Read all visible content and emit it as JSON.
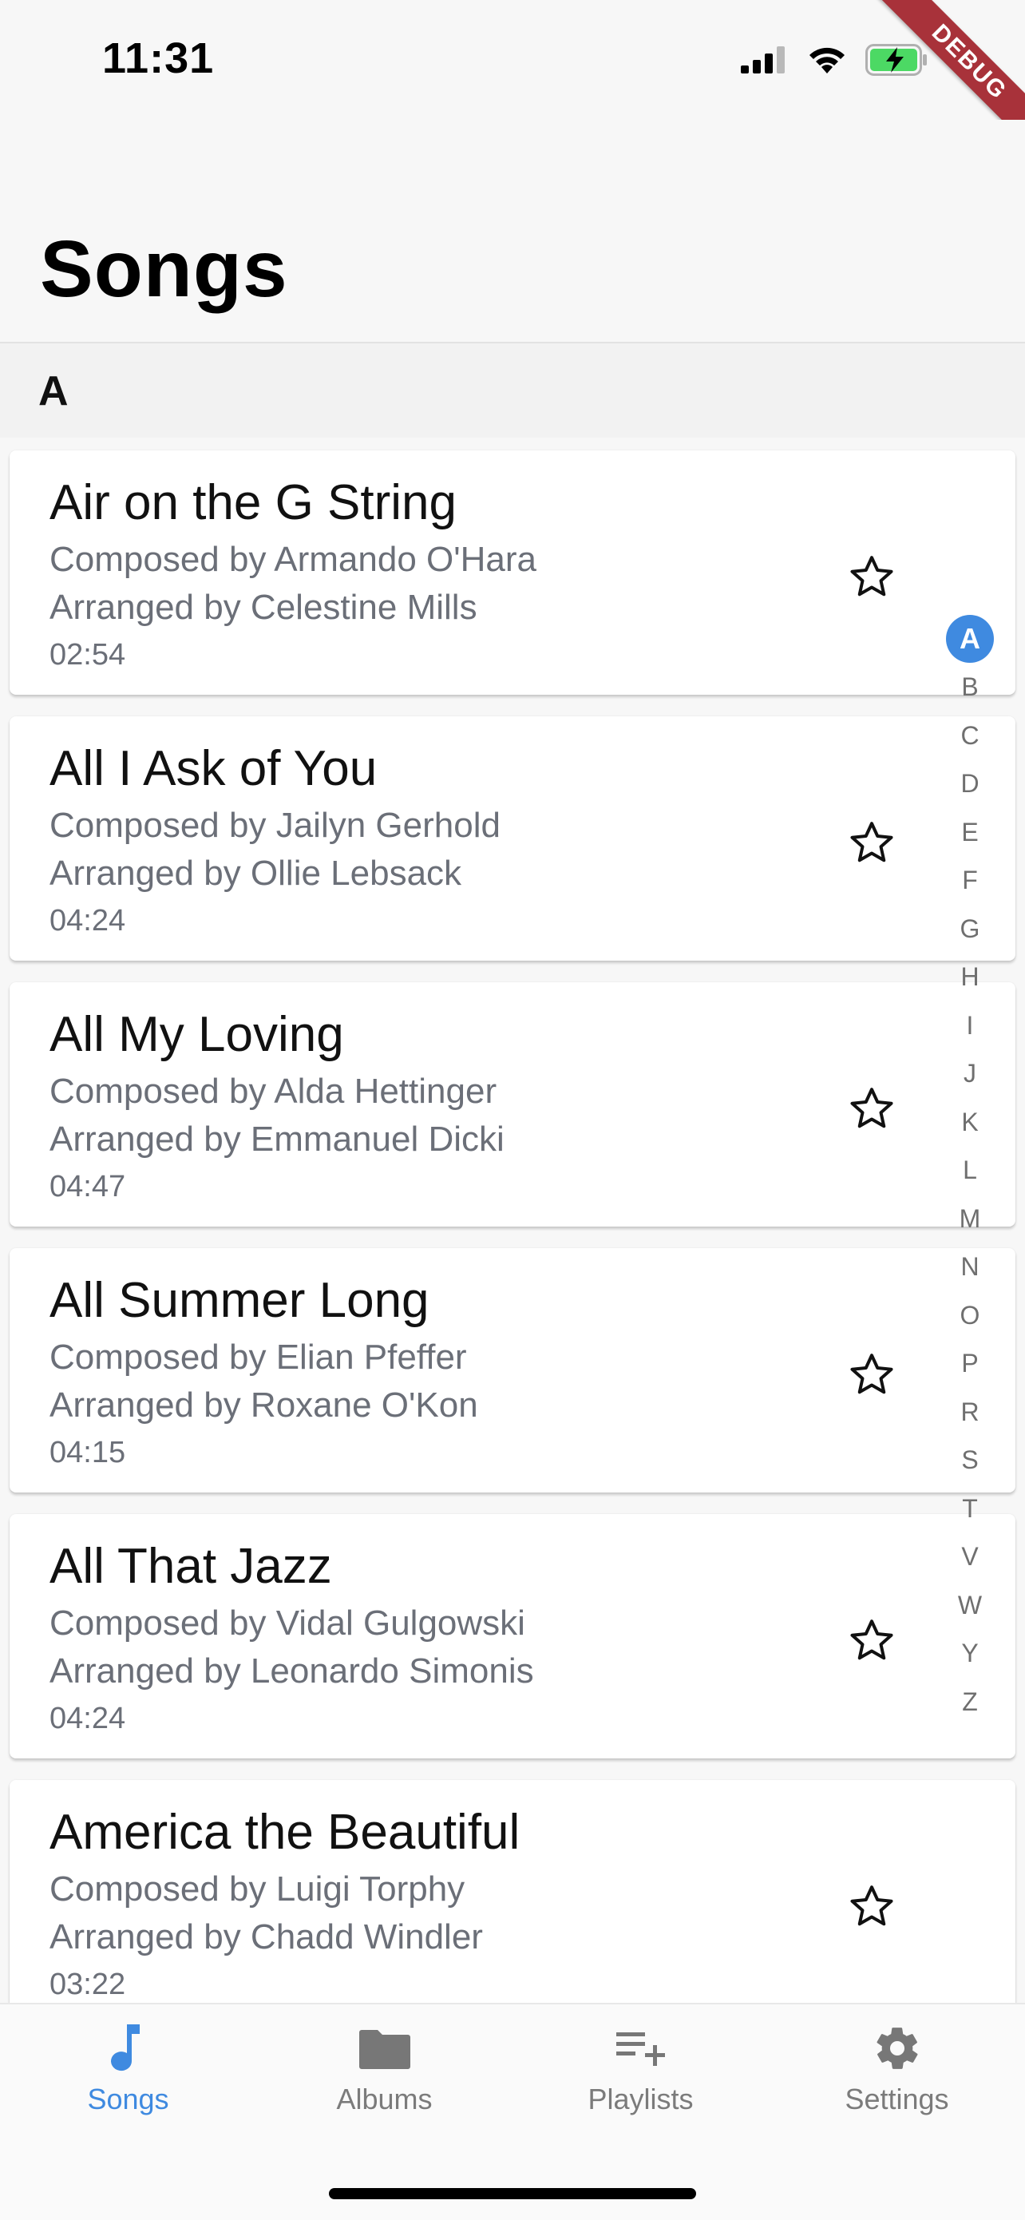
{
  "status_bar": {
    "time": "11:31",
    "debug_label": "DEBUG"
  },
  "header": {
    "title": "Songs"
  },
  "section": {
    "letter": "A"
  },
  "songs": [
    {
      "title": "Air on the G String",
      "composer": "Composed by Armando O'Hara",
      "arranger": "Arranged by Celestine Mills",
      "duration": "02:54",
      "favorite": false
    },
    {
      "title": "All I Ask of You",
      "composer": "Composed by Jailyn Gerhold",
      "arranger": "Arranged by Ollie Lebsack",
      "duration": "04:24",
      "favorite": false
    },
    {
      "title": "All My Loving",
      "composer": "Composed by Alda Hettinger",
      "arranger": "Arranged by Emmanuel Dicki",
      "duration": "04:47",
      "favorite": false
    },
    {
      "title": "All Summer Long",
      "composer": "Composed by Elian Pfeffer",
      "arranger": "Arranged by Roxane O'Kon",
      "duration": "04:15",
      "favorite": false
    },
    {
      "title": "All That Jazz",
      "composer": "Composed by Vidal Gulgowski",
      "arranger": "Arranged by Leonardo Simonis",
      "duration": "04:24",
      "favorite": false
    },
    {
      "title": "America the Beautiful",
      "composer": "Composed by Luigi Torphy",
      "arranger": "Arranged by Chadd Windler",
      "duration": "03:22",
      "favorite": false
    }
  ],
  "alphabet_index": {
    "active": "A",
    "letters": [
      "A",
      "B",
      "C",
      "D",
      "E",
      "F",
      "G",
      "H",
      "I",
      "J",
      "K",
      "L",
      "M",
      "N",
      "O",
      "P",
      "R",
      "S",
      "T",
      "V",
      "W",
      "Y",
      "Z"
    ]
  },
  "tabs": [
    {
      "label": "Songs",
      "icon": "music-note-icon",
      "active": true
    },
    {
      "label": "Albums",
      "icon": "folder-icon",
      "active": false
    },
    {
      "label": "Playlists",
      "icon": "playlist-add-icon",
      "active": false
    },
    {
      "label": "Settings",
      "icon": "gear-icon",
      "active": false
    }
  ],
  "colors": {
    "accent": "#3f8ae0",
    "secondary_text": "#6b6f78",
    "tab_inactive": "#7b7b7b",
    "battery_green": "#4cd964",
    "debug_ribbon": "#a8323a"
  }
}
